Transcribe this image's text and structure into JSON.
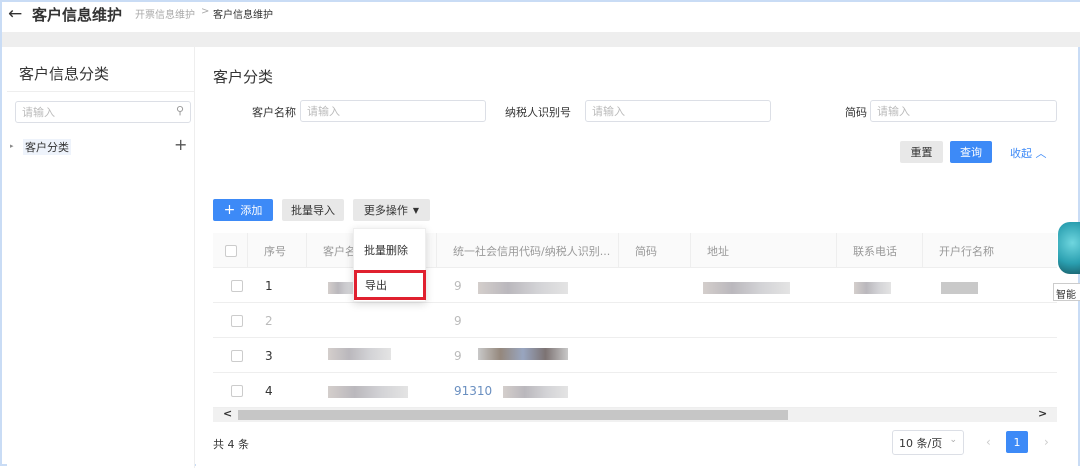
{
  "header": {
    "back_icon": "arrow-left-icon",
    "title": "客户信息维护",
    "breadcrumb": [
      "开票信息维护",
      "客户信息维护"
    ],
    "sep": ">"
  },
  "sidebar": {
    "title": "客户信息分类",
    "search_placeholder": "请输入",
    "tree": [
      {
        "label": "客户分类"
      }
    ],
    "add": "+"
  },
  "main": {
    "title": "客户分类",
    "filters": [
      {
        "label": "客户名称",
        "placeholder": "请输入"
      },
      {
        "label": "纳税人识别号",
        "placeholder": "请输入"
      },
      {
        "label": "简码",
        "placeholder": "请输入"
      }
    ],
    "reset": "重置",
    "query": "查询",
    "collapse": "收起",
    "add": "添加",
    "batch_import": "批量导入",
    "more": "更多操作",
    "more_menu": [
      "批量删除",
      "导出"
    ],
    "columns": [
      "序号",
      "客户名称",
      "统一社会信用代码/纳税人识别...",
      "简码",
      "地址",
      "联系电话",
      "开户行名称"
    ],
    "rows": [
      {
        "index": "1",
        "code": "9"
      },
      {
        "index": "2",
        "code": "9"
      },
      {
        "index": "3",
        "code": "9"
      },
      {
        "index": "4",
        "code": "91310"
      }
    ],
    "total": "共 4 条",
    "page_size": "10 条/页",
    "page": "1"
  },
  "assistant": {
    "label": "智能"
  },
  "colors": {
    "primary": "#3d8af7",
    "highlight": "#e0202f"
  }
}
